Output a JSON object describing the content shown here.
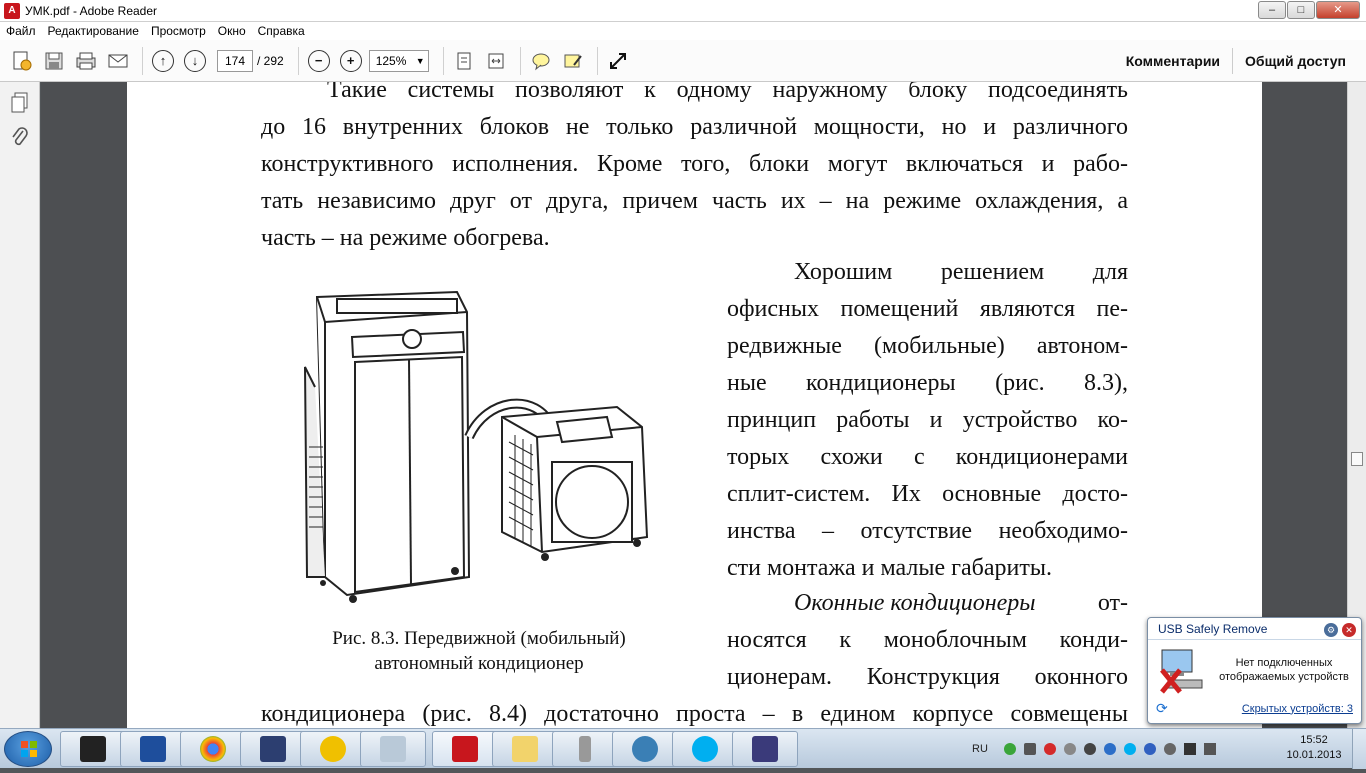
{
  "window": {
    "title": "УМК.pdf - Adobe Reader",
    "minimize": "–",
    "maximize": "□",
    "close": "✕"
  },
  "menu": [
    "Файл",
    "Редактирование",
    "Просмотр",
    "Окно",
    "Справка"
  ],
  "toolbar": {
    "page_current": "174",
    "page_total": "/ 292",
    "zoom": "125%",
    "comments_label": "Комментарии",
    "share_label": "Общий доступ"
  },
  "document": {
    "lines_full_top": [
      "Такие системы позволяют к одному наружному блоку подсоединять",
      "до 16 внутренних блоков не только различной мощности, но и различного",
      "конструктивного исполнения. Кроме того, блоки могут включаться и рабо-",
      "тать независимо друг от друга, причем часть их – на режиме охлаждения, а",
      "часть – на режиме обогрева."
    ],
    "lines_right": [
      "Хорошим решением для",
      "офисных помещений являются пе-",
      "редвижные (мобильные) автоном-",
      "ные кондиционеры (рис. 8.3),",
      "принцип работы и устройство ко-",
      "торых схожи с кондиционерами",
      "сплит-систем. Их основные досто-",
      "инства – отсутствие необходимо-",
      "сти монтажа и малые габариты."
    ],
    "italic_term": "Оконные кондиционеры",
    "italic_rest": "от-",
    "lines_right_after": [
      "носятся к моноблочным конди-",
      "ционерам. Конструкция оконного"
    ],
    "line_bottom": "кондиционера (рис. 8.4) достаточно проста – в едином корпусе совмещены",
    "caption_line1": "Рис. 8.3. Передвижной (мобильный)",
    "caption_line2": "автономный кондиционер"
  },
  "usb_popup": {
    "title": "USB Safely Remove",
    "message": "Нет подключенных отображаемых устройств",
    "hidden": "Скрытых устройств: 3"
  },
  "taskbar": {
    "lang": "RU",
    "time": "15:52",
    "date": "10.01.2013"
  },
  "colors": {
    "accent_red": "#c8161d",
    "taskbar": "#c6d5e5",
    "page_bg": "#ffffff"
  }
}
